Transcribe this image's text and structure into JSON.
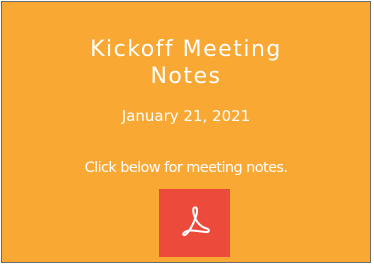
{
  "card": {
    "title": "Kickoff Meeting\nNotes",
    "date": "January 21, 2021",
    "prompt": "Click below for meeting notes.",
    "button_icon": "acrobat-pdf-icon"
  },
  "colors": {
    "background": "#f9a833",
    "button": "#ec4a3b",
    "text": "#ffffff"
  }
}
